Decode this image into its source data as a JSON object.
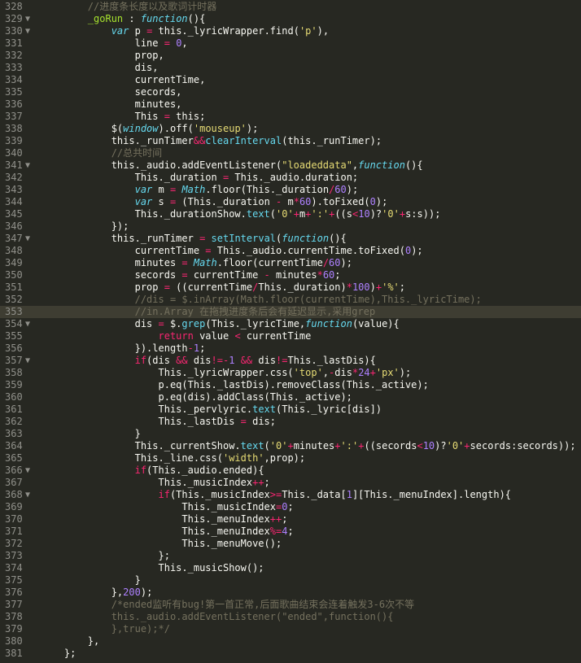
{
  "editor": {
    "theme_colors": {
      "background": "#272822",
      "keyword": "#f92672",
      "storage": "#66d9ef",
      "string": "#e6db74",
      "number": "#ae81ff",
      "comment": "#75715e",
      "function_name": "#a6e22e",
      "text": "#f8f8f2"
    },
    "current_line": 353,
    "lines": [
      {
        "n": "328",
        "fold": false,
        "code": "        //进度条长度以及歌词计时器"
      },
      {
        "n": "329",
        "fold": true,
        "code": "        _goRun : function(){"
      },
      {
        "n": "330",
        "fold": true,
        "code": "            var p = this._lyricWrapper.find('p'),"
      },
      {
        "n": "331",
        "fold": false,
        "code": "                line = 0,"
      },
      {
        "n": "332",
        "fold": false,
        "code": "                prop,"
      },
      {
        "n": "333",
        "fold": false,
        "code": "                dis,"
      },
      {
        "n": "334",
        "fold": false,
        "code": "                currentTime,"
      },
      {
        "n": "335",
        "fold": false,
        "code": "                secords,"
      },
      {
        "n": "336",
        "fold": false,
        "code": "                minutes,"
      },
      {
        "n": "337",
        "fold": false,
        "code": "                This = this;"
      },
      {
        "n": "338",
        "fold": false,
        "code": "            $(window).off('mouseup');"
      },
      {
        "n": "339",
        "fold": false,
        "code": "            this._runTimer&&clearInterval(this._runTimer);"
      },
      {
        "n": "340",
        "fold": false,
        "code": "            //总共时间"
      },
      {
        "n": "341",
        "fold": true,
        "code": "            this._audio.addEventListener(\"loadeddata\",function(){"
      },
      {
        "n": "342",
        "fold": false,
        "code": "                This._duration = This._audio.duration;"
      },
      {
        "n": "343",
        "fold": false,
        "code": "                var m = Math.floor(This._duration/60);"
      },
      {
        "n": "344",
        "fold": false,
        "code": "                var s = (This._duration - m*60).toFixed(0);"
      },
      {
        "n": "345",
        "fold": false,
        "code": "                This._durationShow.text('0'+m+':'+((s<10)?'0'+s:s));"
      },
      {
        "n": "346",
        "fold": false,
        "code": "            });"
      },
      {
        "n": "347",
        "fold": true,
        "code": "            this._runTimer = setInterval(function(){"
      },
      {
        "n": "348",
        "fold": false,
        "code": "                currentTime = This._audio.currentTime.toFixed(0);"
      },
      {
        "n": "349",
        "fold": false,
        "code": "                minutes = Math.floor(currentTime/60);"
      },
      {
        "n": "350",
        "fold": false,
        "code": "                secords = currentTime - minutes*60;"
      },
      {
        "n": "351",
        "fold": false,
        "code": "                prop = ((currentTime/This._duration)*100)+'%';"
      },
      {
        "n": "352",
        "fold": false,
        "code": "                //dis = $.inArray(Math.floor(currentTime),This._lyricTime);"
      },
      {
        "n": "353",
        "fold": false,
        "code": "                //in.Array 在拖拽进度条后会有延迟显示,采用grep"
      },
      {
        "n": "354",
        "fold": true,
        "code": "                dis = $.grep(This._lyricTime,function(value){"
      },
      {
        "n": "355",
        "fold": false,
        "code": "                    return value < currentTime"
      },
      {
        "n": "356",
        "fold": false,
        "code": "                }).length-1;"
      },
      {
        "n": "357",
        "fold": true,
        "code": "                if(dis && dis!=-1 && dis!=This._lastDis){"
      },
      {
        "n": "358",
        "fold": false,
        "code": "                    This._lyricWrapper.css('top',-dis*24+'px');"
      },
      {
        "n": "359",
        "fold": false,
        "code": "                    p.eq(This._lastDis).removeClass(This._active);"
      },
      {
        "n": "360",
        "fold": false,
        "code": "                    p.eq(dis).addClass(This._active);"
      },
      {
        "n": "361",
        "fold": false,
        "code": "                    This._pervlyric.text(This._lyric[dis])"
      },
      {
        "n": "362",
        "fold": false,
        "code": "                    This._lastDis = dis;"
      },
      {
        "n": "363",
        "fold": false,
        "code": "                }"
      },
      {
        "n": "364",
        "fold": false,
        "code": "                This._currentShow.text('0'+minutes+':'+((secords<10)?'0'+secords:secords));"
      },
      {
        "n": "365",
        "fold": false,
        "code": "                This._line.css('width',prop);"
      },
      {
        "n": "366",
        "fold": true,
        "code": "                if(This._audio.ended){"
      },
      {
        "n": "367",
        "fold": false,
        "code": "                    This._musicIndex++;"
      },
      {
        "n": "368",
        "fold": true,
        "code": "                    if(This._musicIndex>=This._data[1][This._menuIndex].length){"
      },
      {
        "n": "369",
        "fold": false,
        "code": "                        This._musicIndex=0;"
      },
      {
        "n": "370",
        "fold": false,
        "code": "                        This._menuIndex++;"
      },
      {
        "n": "371",
        "fold": false,
        "code": "                        This._menuIndex%=4;"
      },
      {
        "n": "372",
        "fold": false,
        "code": "                        This._menuMove();"
      },
      {
        "n": "373",
        "fold": false,
        "code": "                    };"
      },
      {
        "n": "374",
        "fold": false,
        "code": "                    This._musicShow();"
      },
      {
        "n": "375",
        "fold": false,
        "code": "                }"
      },
      {
        "n": "376",
        "fold": false,
        "code": "            },200);"
      },
      {
        "n": "377",
        "fold": false,
        "code": "            /*ended监听有bug!第一首正常,后面歌曲结束会连着触发3-6次不等"
      },
      {
        "n": "378",
        "fold": false,
        "code": "            this._audio.addEventListener(\"ended\",function(){"
      },
      {
        "n": "379",
        "fold": false,
        "code": "            },true);*/"
      },
      {
        "n": "380",
        "fold": false,
        "code": "        },"
      },
      {
        "n": "381",
        "fold": false,
        "code": "    };"
      }
    ]
  }
}
